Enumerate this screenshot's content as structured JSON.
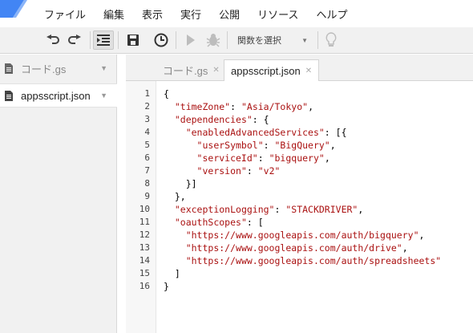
{
  "colors": {
    "logo_blue": "#4285f4",
    "toolbar_bg": "#f1f1f1",
    "json_key": "#aa1111",
    "json_string": "#aa1111"
  },
  "menu": {
    "items": [
      "ファイル",
      "編集",
      "表示",
      "実行",
      "公開",
      "リソース",
      "ヘルプ"
    ]
  },
  "toolbar": {
    "icons": [
      "undo-icon",
      "redo-icon",
      "indent-icon",
      "save-icon",
      "timer-trigger-icon",
      "run-icon",
      "debug-bug-icon",
      "lightbulb-icon"
    ],
    "function_select_label": "関数を選択"
  },
  "sidebar": {
    "files": [
      {
        "name": "コード.gs"
      },
      {
        "name": "appsscript.json"
      }
    ]
  },
  "tabs": [
    {
      "label": "コード.gs"
    },
    {
      "label": "appsscript.json"
    }
  ],
  "editor": {
    "lines": [
      [
        {
          "t": "{",
          "c": "p"
        }
      ],
      [
        {
          "t": "  ",
          "c": "p"
        },
        {
          "t": "\"timeZone\"",
          "c": "k"
        },
        {
          "t": ": ",
          "c": "p"
        },
        {
          "t": "\"Asia/Tokyo\"",
          "c": "s"
        },
        {
          "t": ",",
          "c": "p"
        }
      ],
      [
        {
          "t": "  ",
          "c": "p"
        },
        {
          "t": "\"dependencies\"",
          "c": "k"
        },
        {
          "t": ": {",
          "c": "p"
        }
      ],
      [
        {
          "t": "    ",
          "c": "p"
        },
        {
          "t": "\"enabledAdvancedServices\"",
          "c": "k"
        },
        {
          "t": ": [{",
          "c": "p"
        }
      ],
      [
        {
          "t": "      ",
          "c": "p"
        },
        {
          "t": "\"userSymbol\"",
          "c": "k"
        },
        {
          "t": ": ",
          "c": "p"
        },
        {
          "t": "\"BigQuery\"",
          "c": "s"
        },
        {
          "t": ",",
          "c": "p"
        }
      ],
      [
        {
          "t": "      ",
          "c": "p"
        },
        {
          "t": "\"serviceId\"",
          "c": "k"
        },
        {
          "t": ": ",
          "c": "p"
        },
        {
          "t": "\"bigquery\"",
          "c": "s"
        },
        {
          "t": ",",
          "c": "p"
        }
      ],
      [
        {
          "t": "      ",
          "c": "p"
        },
        {
          "t": "\"version\"",
          "c": "k"
        },
        {
          "t": ": ",
          "c": "p"
        },
        {
          "t": "\"v2\"",
          "c": "s"
        }
      ],
      [
        {
          "t": "    }]",
          "c": "p"
        }
      ],
      [
        {
          "t": "  },",
          "c": "p"
        }
      ],
      [
        {
          "t": "  ",
          "c": "p"
        },
        {
          "t": "\"exceptionLogging\"",
          "c": "k"
        },
        {
          "t": ": ",
          "c": "p"
        },
        {
          "t": "\"STACKDRIVER\"",
          "c": "s"
        },
        {
          "t": ",",
          "c": "p"
        }
      ],
      [
        {
          "t": "  ",
          "c": "p"
        },
        {
          "t": "\"oauthScopes\"",
          "c": "k"
        },
        {
          "t": ": [",
          "c": "p"
        }
      ],
      [
        {
          "t": "    ",
          "c": "p"
        },
        {
          "t": "\"https://www.googleapis.com/auth/bigquery\"",
          "c": "s"
        },
        {
          "t": ",",
          "c": "p"
        }
      ],
      [
        {
          "t": "    ",
          "c": "p"
        },
        {
          "t": "\"https://www.googleapis.com/auth/drive\"",
          "c": "s"
        },
        {
          "t": ",",
          "c": "p"
        }
      ],
      [
        {
          "t": "    ",
          "c": "p"
        },
        {
          "t": "\"https://www.googleapis.com/auth/spreadsheets\"",
          "c": "s"
        }
      ],
      [
        {
          "t": "  ]",
          "c": "p"
        }
      ],
      [
        {
          "t": "}",
          "c": "p"
        }
      ]
    ]
  }
}
